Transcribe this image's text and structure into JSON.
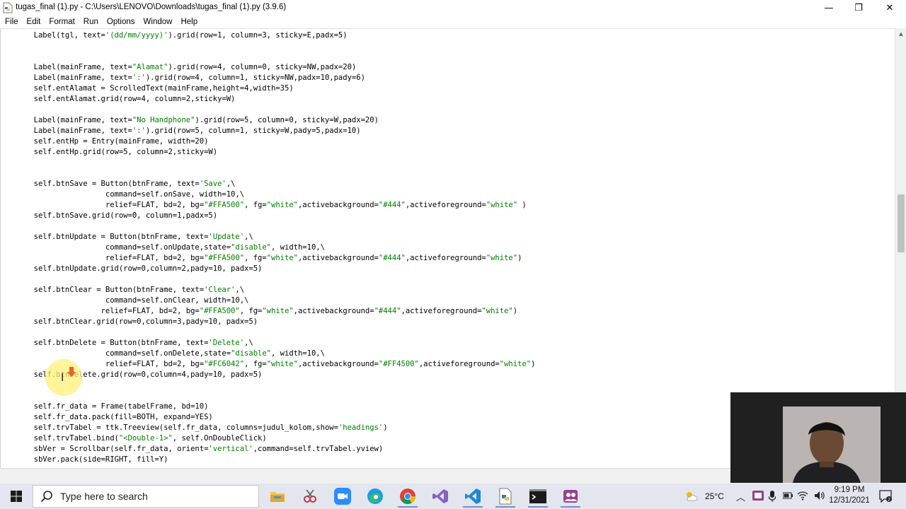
{
  "window": {
    "title": "tugas_final (1).py - C:\\Users\\LENOVO\\Downloads\\tugas_final (1).py (3.9.6)",
    "min_glyph": "—",
    "max_glyph": "❐",
    "close_glyph": "✕"
  },
  "menu": [
    "File",
    "Edit",
    "Format",
    "Run",
    "Options",
    "Window",
    "Help"
  ],
  "code_lines": [
    [
      [
        "        Label(tgl, text=",
        ""
      ],
      [
        "'(dd/mm/yyyy)'",
        "s"
      ],
      [
        ").grid(row=1, column=3, sticky=E,padx=5)",
        ""
      ]
    ],
    [
      [
        "",
        ""
      ]
    ],
    [
      [
        "",
        ""
      ]
    ],
    [
      [
        "        Label(mainFrame, text=",
        ""
      ],
      [
        "\"Alamat\"",
        "s"
      ],
      [
        ").grid(row=4, column=0, sticky=NW,padx=20)",
        ""
      ]
    ],
    [
      [
        "        Label(mainFrame, text=",
        ""
      ],
      [
        "':'",
        "s"
      ],
      [
        ").grid(row=4, column=1, sticky=NW,padx=10,pady=6)",
        ""
      ]
    ],
    [
      [
        "        self.entAlamat = ScrolledText(mainFrame,height=4,width=35)",
        ""
      ]
    ],
    [
      [
        "        self.entAlamat.grid(row=4, column=2,sticky=W)",
        ""
      ]
    ],
    [
      [
        "",
        ""
      ]
    ],
    [
      [
        "        Label(mainFrame, text=",
        ""
      ],
      [
        "\"No Handphone\"",
        "s"
      ],
      [
        ").grid(row=5, column=0, sticky=W,padx=20)",
        ""
      ]
    ],
    [
      [
        "        Label(mainFrame, text=",
        ""
      ],
      [
        "':'",
        "s"
      ],
      [
        ").grid(row=5, column=1, sticky=W,pady=5,padx=10)",
        ""
      ]
    ],
    [
      [
        "        self.entHp = Entry(mainFrame, width=20)",
        ""
      ]
    ],
    [
      [
        "        self.entHp.grid(row=5, column=2,sticky=W)",
        ""
      ]
    ],
    [
      [
        "",
        ""
      ]
    ],
    [
      [
        "",
        ""
      ]
    ],
    [
      [
        "        self.btnSave = Button(btnFrame, text=",
        ""
      ],
      [
        "'Save'",
        "s"
      ],
      [
        ",\\",
        ""
      ]
    ],
    [
      [
        "                        command=self.onSave, width=10,\\",
        ""
      ]
    ],
    [
      [
        "                        relief=FLAT, bd=2, bg=",
        ""
      ],
      [
        "\"#FFA500\"",
        "s"
      ],
      [
        ", fg=",
        ""
      ],
      [
        "\"white\"",
        "s"
      ],
      [
        ",activebackground=",
        ""
      ],
      [
        "\"#444\"",
        "s"
      ],
      [
        ",activeforeground=",
        ""
      ],
      [
        "\"white\"",
        "s"
      ],
      [
        " )",
        ""
      ]
    ],
    [
      [
        "        self.btnSave.grid(row=0, column=1,padx=5)",
        ""
      ]
    ],
    [
      [
        "",
        ""
      ]
    ],
    [
      [
        "        self.btnUpdate = Button(btnFrame, text=",
        ""
      ],
      [
        "'Update'",
        "s"
      ],
      [
        ",\\",
        ""
      ]
    ],
    [
      [
        "                        command=self.onUpdate,state=",
        ""
      ],
      [
        "\"disable\"",
        "s"
      ],
      [
        ", width=10,\\",
        ""
      ]
    ],
    [
      [
        "                        relief=FLAT, bd=2, bg=",
        ""
      ],
      [
        "\"#FFA500\"",
        "s"
      ],
      [
        ", fg=",
        ""
      ],
      [
        "\"white\"",
        "s"
      ],
      [
        ",activebackground=",
        ""
      ],
      [
        "\"#444\"",
        "s"
      ],
      [
        ",activeforeground=",
        ""
      ],
      [
        "\"white\"",
        "s"
      ],
      [
        ")",
        ""
      ]
    ],
    [
      [
        "        self.btnUpdate.grid(row=0,column=2,pady=10, padx=5)",
        ""
      ]
    ],
    [
      [
        "",
        ""
      ]
    ],
    [
      [
        "        self.btnClear = Button(btnFrame, text=",
        ""
      ],
      [
        "'Clear'",
        "s"
      ],
      [
        ",\\",
        ""
      ]
    ],
    [
      [
        "                        command=self.onClear, width=10,\\",
        ""
      ]
    ],
    [
      [
        "                       relief=FLAT, bd=2, bg=",
        ""
      ],
      [
        "\"#FFA500\"",
        "s"
      ],
      [
        ", fg=",
        ""
      ],
      [
        "\"white\"",
        "s"
      ],
      [
        ",activebackground=",
        ""
      ],
      [
        "\"#444\"",
        "s"
      ],
      [
        ",activeforeground=",
        ""
      ],
      [
        "\"white\"",
        "s"
      ],
      [
        ")",
        ""
      ]
    ],
    [
      [
        "        self.btnClear.grid(row=0,column=3,pady=10, padx=5)",
        ""
      ]
    ],
    [
      [
        "",
        ""
      ]
    ],
    [
      [
        "        self.btnDelete = Button(btnFrame, text=",
        ""
      ],
      [
        "'Delete'",
        "s"
      ],
      [
        ",\\",
        ""
      ]
    ],
    [
      [
        "                        command=self.onDelete,state=",
        ""
      ],
      [
        "\"disable\"",
        "s"
      ],
      [
        ", width=10,\\",
        ""
      ]
    ],
    [
      [
        "                        relief=FLAT, bd=2, bg=",
        ""
      ],
      [
        "\"#FC6042\"",
        "s"
      ],
      [
        ", fg=",
        ""
      ],
      [
        "\"white\"",
        "s"
      ],
      [
        ",activebackground=",
        ""
      ],
      [
        "\"#FF4500\"",
        "s"
      ],
      [
        ",activeforeground=",
        ""
      ],
      [
        "\"white\"",
        "s"
      ],
      [
        ")",
        ""
      ]
    ],
    [
      [
        "        self.btnDelete.grid(row=0,column=4,pady=10, padx=5)",
        ""
      ]
    ],
    [
      [
        "",
        ""
      ]
    ],
    [
      [
        "",
        ""
      ]
    ],
    [
      [
        "        self.fr_data = Frame(tabelFrame, bd=10)",
        ""
      ]
    ],
    [
      [
        "        self.fr_data.pack(fill=BOTH, expand=YES)",
        ""
      ]
    ],
    [
      [
        "        self.trvTabel = ttk.Treeview(self.fr_data, columns=judul_kolom,show=",
        ""
      ],
      [
        "'headings'",
        "s"
      ],
      [
        ")",
        ""
      ]
    ],
    [
      [
        "        self.trvTabel.bind(",
        ""
      ],
      [
        "\"<Double-1>\"",
        "s"
      ],
      [
        ", self.OnDoubleClick)",
        ""
      ]
    ],
    [
      [
        "        sbVer = Scrollbar(self.fr_data, orient=",
        ""
      ],
      [
        "'vertical'",
        "s"
      ],
      [
        ",command=self.trvTabel.yview)",
        ""
      ]
    ],
    [
      [
        "        sbVer.pack(side=RIGHT, fill=Y)",
        ""
      ]
    ]
  ],
  "taskbar": {
    "search_placeholder": "Type here to search",
    "weather": "25°C",
    "time": "9:19 PM",
    "date": "12/31/2021"
  },
  "colors": {
    "string_green": "#008000",
    "taskbar_bg": "#e3e6ee",
    "accent": "#6f8fc9"
  }
}
